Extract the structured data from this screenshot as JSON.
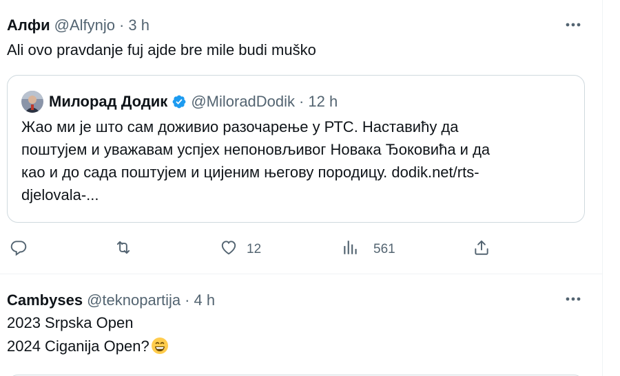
{
  "tweets": [
    {
      "name": "Алфи",
      "handle": "@Alfynjo",
      "separator": "·",
      "time": "3 h",
      "text": "Ali ovo pravdanje fuj ajde bre mile budi muško",
      "quote": {
        "name": "Милорад Додик",
        "handle": "@MiloradDodik",
        "separator": "·",
        "time": "12 h",
        "text_lines": [
          "Жао ми је што сам доживио разочарење у РТС. Наставићу да",
          "поштујем и уважавам успјех непоновљивог Новака Ђоковића и да",
          "као и до сада поштујем и цијеним његову породицу. dodik.net/rts-",
          "djelovala-..."
        ]
      },
      "actions": {
        "reply_icon": "reply-icon",
        "retweet_icon": "retweet-icon",
        "like_icon": "heart-icon",
        "like_count": "12",
        "views_icon": "views-icon",
        "views_count": "561",
        "share_icon": "share-icon"
      }
    },
    {
      "name": "Cambyses",
      "handle": "@teknopartija",
      "separator": "·",
      "time": "4 h",
      "text_lines": [
        "2023 Srpska Open",
        "2024 Ciganija Open?"
      ],
      "emoji": "grinning-face-emoji"
    }
  ],
  "colors": {
    "text": "#0f1419",
    "secondary": "#536471",
    "border": "#cfd9de",
    "verified": "#1d9bf0"
  }
}
